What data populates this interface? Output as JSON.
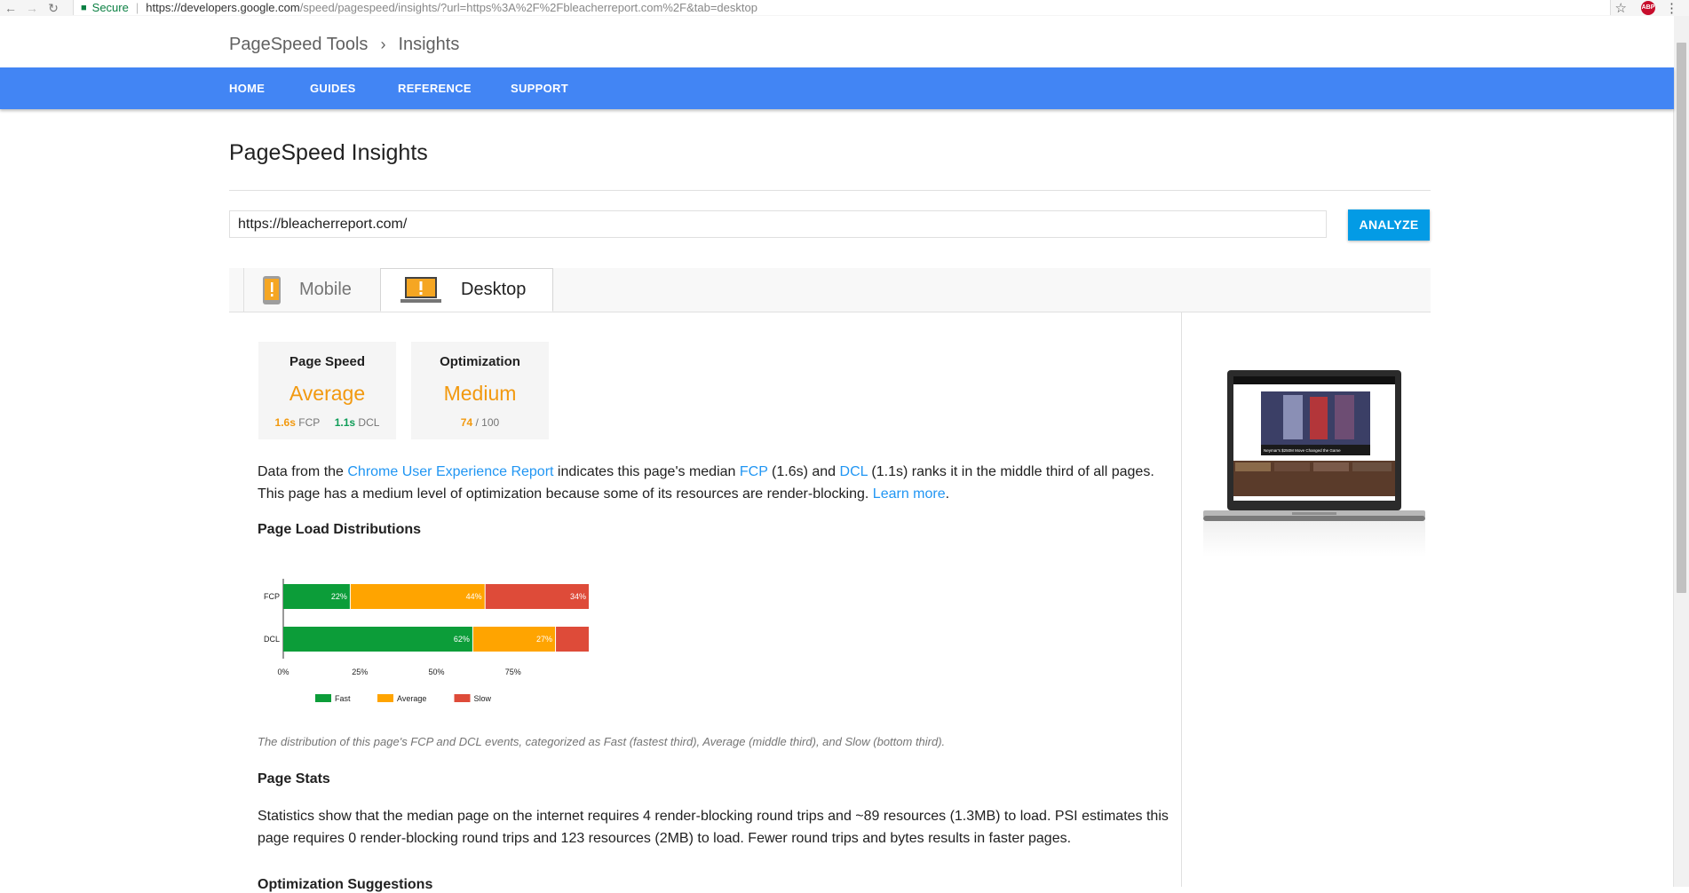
{
  "browser": {
    "secure_label": "Secure",
    "url_host": "https://developers.google.com",
    "url_rest": "/speed/pagespeed/insights/?url=https%3A%2F%2Fbleacherreport.com%2F&tab=desktop",
    "adblock_label": "ABP"
  },
  "header": {
    "breadcrumb_root": "PageSpeed Tools",
    "breadcrumb_current": "Insights"
  },
  "nav": {
    "items": [
      "HOME",
      "GUIDES",
      "REFERENCE",
      "SUPPORT"
    ]
  },
  "page": {
    "title": "PageSpeed Insights",
    "url_value": "https://bleacherreport.com/",
    "analyze_label": "ANALYZE"
  },
  "tabs": [
    {
      "label": "Mobile",
      "selected": false,
      "icon": "phone-warning-icon"
    },
    {
      "label": "Desktop",
      "selected": true,
      "icon": "laptop-warning-icon"
    }
  ],
  "cards": {
    "speed": {
      "title": "Page Speed",
      "value": "Average",
      "fcp_value": "1.6s",
      "fcp_label": "FCP",
      "dcl_value": "1.1s",
      "dcl_label": "DCL"
    },
    "optimization": {
      "title": "Optimization",
      "value": "Medium",
      "score": "74",
      "score_max": "/ 100"
    }
  },
  "description": {
    "p1_a": "Data from the ",
    "p1_link1": "Chrome User Experience Report",
    "p1_b": " indicates this page's median ",
    "p1_link2": "FCP",
    "p1_c": " (1.6s) and ",
    "p1_link3": "DCL",
    "p1_d": " (1.1s) ranks it in the middle third of all pages.",
    "p2_a": "This page has a medium level of optimization because some of its resources are render-blocking. ",
    "p2_link": "Learn more",
    "p2_b": "."
  },
  "distributions": {
    "heading": "Page Load Distributions",
    "caption": "The distribution of this page's FCP and DCL events, categorized as Fast (fastest third), Average (middle third), and Slow (bottom third)."
  },
  "chart_data": {
    "type": "bar",
    "orientation": "horizontal",
    "stacked": true,
    "categories": [
      "FCP",
      "DCL"
    ],
    "series": [
      {
        "name": "Fast",
        "values": [
          22,
          62
        ],
        "labels": [
          "22%",
          "62%"
        ],
        "color": "#0c9d39"
      },
      {
        "name": "Average",
        "values": [
          44,
          27
        ],
        "labels": [
          "44%",
          "27%"
        ],
        "color": "#ffa400"
      },
      {
        "name": "Slow",
        "values": [
          34,
          11
        ],
        "labels": [
          "34%",
          ""
        ],
        "color": "#de4b39"
      }
    ],
    "x_ticks": [
      "0%",
      "25%",
      "50%",
      "75%"
    ],
    "xlim": [
      0,
      100
    ],
    "legend_position": "bottom"
  },
  "stats": {
    "heading": "Page Stats",
    "text": "Statistics show that the median page on the internet requires 4 render-blocking round trips and ~89 resources (1.3MB) to load. PSI estimates this page requires 0 render-blocking round trips and 123 resources (2MB) to load. Fewer round trips and bytes results in faster pages."
  },
  "suggestions": {
    "heading": "Optimization Suggestions"
  },
  "preview": {
    "headline": "Neymar's $250M Move Changed the Game"
  }
}
